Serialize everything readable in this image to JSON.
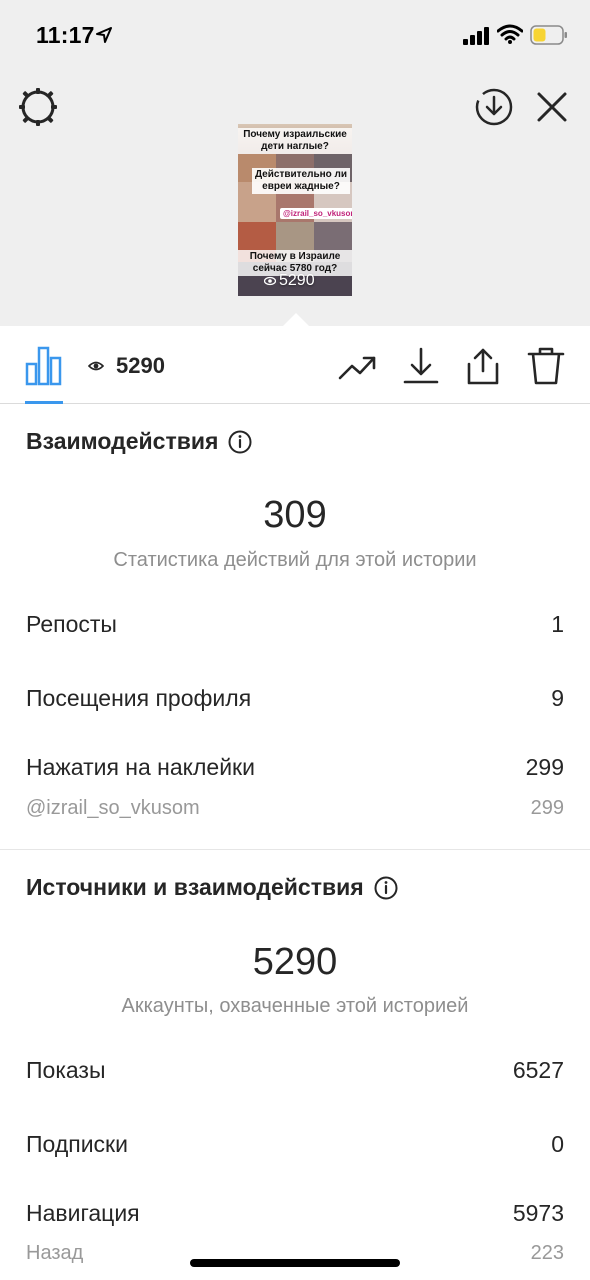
{
  "status_bar": {
    "time": "11:17",
    "battery_color": "#f7d433"
  },
  "story_preview": {
    "caption_1": "Почему израильские дети наглые?",
    "caption_2": "Действительно ли евреи жадные?",
    "mention_tag": "@izrail_so_vkusom",
    "caption_3": "Почему в Израиле сейчас 5780 год?",
    "views": "5290"
  },
  "toolbar": {
    "views": "5290",
    "active_tab_color": "#3a97ed",
    "icons": [
      "stats-icon",
      "eye-icon",
      "trend-icon",
      "download-icon",
      "share-icon",
      "trash-icon"
    ]
  },
  "interactions": {
    "title": "Взаимодействия",
    "total": "309",
    "subtitle": "Статистика действий для этой истории",
    "rows": [
      {
        "label": "Репосты",
        "value": "1"
      },
      {
        "label": "Посещения профиля",
        "value": "9"
      },
      {
        "label": "Нажатия на наклейки",
        "value": "299"
      }
    ],
    "sticker": {
      "label": "@izrail_so_vkusom",
      "value": "299"
    }
  },
  "discovery": {
    "title": "Источники и взаимодействия",
    "total": "5290",
    "subtitle": "Аккаунты, охваченные этой историей",
    "rows": [
      {
        "label": "Показы",
        "value": "6527"
      },
      {
        "label": "Подписки",
        "value": "0"
      },
      {
        "label": "Навигация",
        "value": "5973"
      }
    ],
    "back": {
      "label": "Назад",
      "value": "223"
    }
  }
}
